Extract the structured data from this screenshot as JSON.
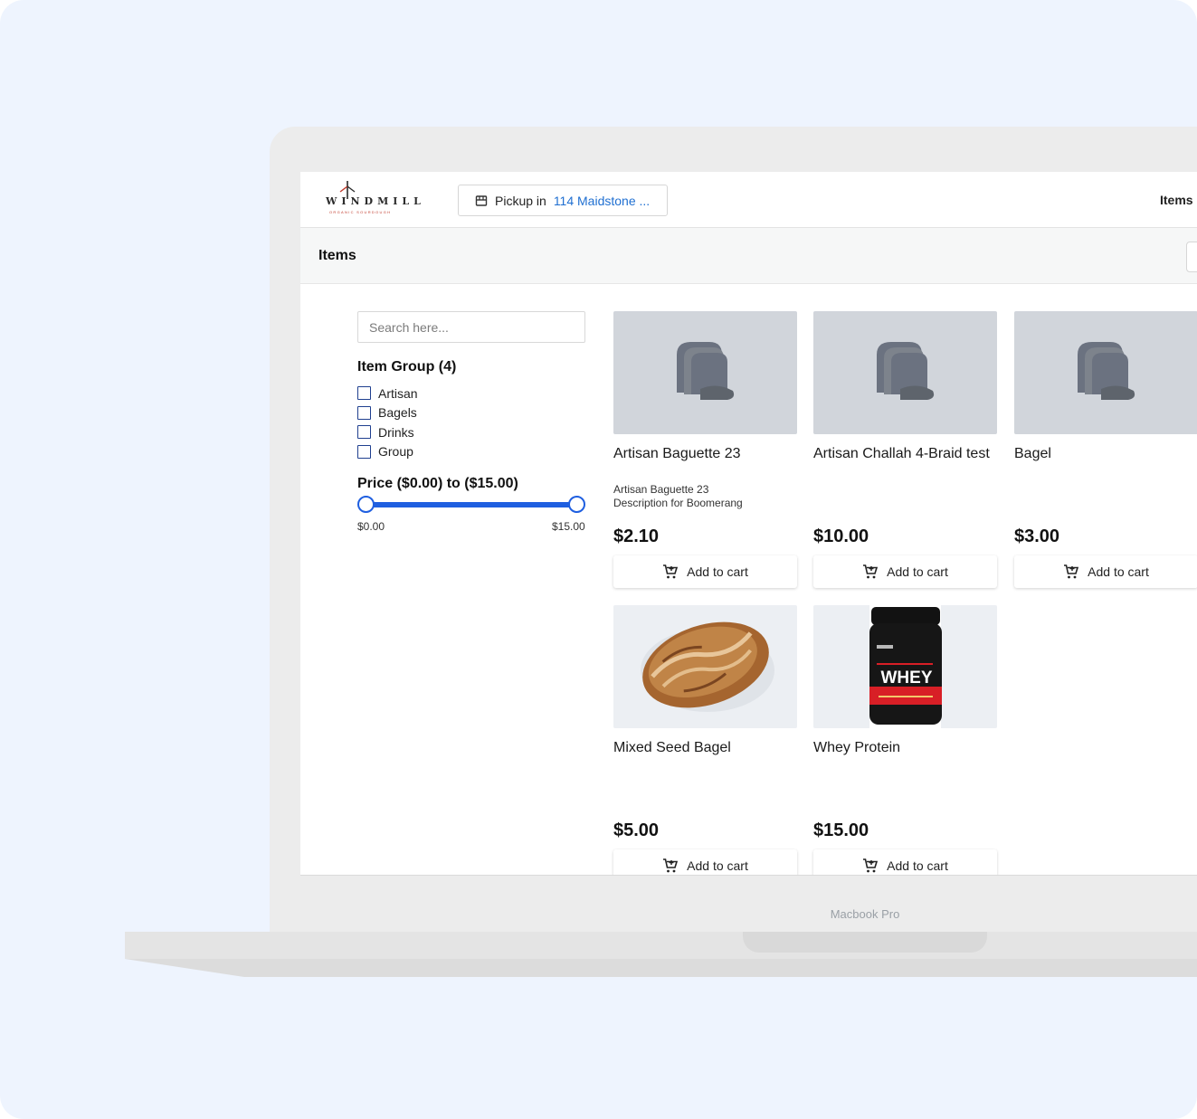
{
  "header": {
    "logo_word": "WINDMILL",
    "logo_sub": "ORGANIC SOURDOUGH",
    "pickup_prefix": "Pickup in",
    "pickup_address": "114 Maidstone ...",
    "nav_items_label": "Items"
  },
  "subbar": {
    "title": "Items"
  },
  "sidebar": {
    "search_placeholder": "Search here...",
    "item_group_title": "Item Group (4)",
    "item_groups": [
      {
        "label": "Artisan"
      },
      {
        "label": "Bagels"
      },
      {
        "label": "Drinks"
      },
      {
        "label": "Group"
      }
    ],
    "price_title": "Price ($0.00) to ($15.00)",
    "price_min_label": "$0.00",
    "price_max_label": "$15.00",
    "price_range": {
      "min": 0,
      "max": 15,
      "low": 0,
      "high": 15
    }
  },
  "products": [
    {
      "name": "Artisan Baguette 23",
      "description": "Artisan Baguette 23\nDescription for Boomerang",
      "price": "$2.10",
      "image": "bread-placeholder-icon",
      "button": "Add to cart"
    },
    {
      "name": "Artisan Challah 4-Braid test",
      "description": "",
      "price": "$10.00",
      "image": "bread-placeholder-icon",
      "button": "Add to cart"
    },
    {
      "name": "Bagel",
      "description": "",
      "price": "$3.00",
      "image": "bread-placeholder-icon",
      "button": "Add to cart"
    },
    {
      "name": "Mixed Seed Bagel",
      "description": "",
      "price": "$5.00",
      "image": "sourdough-loaf-photo",
      "button": "Add to cart"
    },
    {
      "name": "Whey Protein",
      "description": "",
      "price": "$15.00",
      "image": "whey-protein-tub-photo",
      "button": "Add to cart",
      "image_text": "WHEY"
    }
  ],
  "device": {
    "label": "Macbook Pro"
  },
  "colors": {
    "accent": "#1f5fe0",
    "link": "#1f6fd1",
    "background": "#eef4fe"
  }
}
